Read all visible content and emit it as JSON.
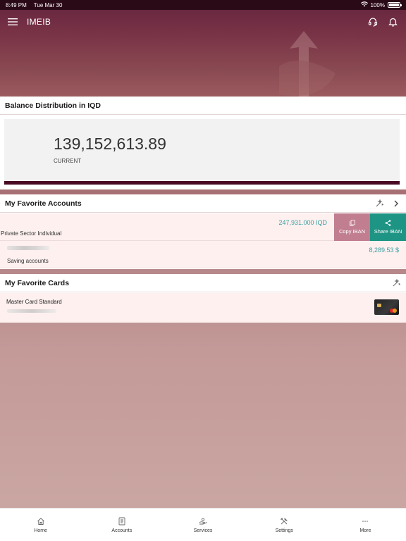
{
  "status_bar": {
    "time": "8:49 PM",
    "date": "Tue Mar 30",
    "battery": "100%",
    "battery_level": 1.0
  },
  "header": {
    "app_title": "IMEIB",
    "icons": [
      "menu-icon",
      "headset-icon",
      "bell-icon"
    ]
  },
  "balance": {
    "title": "Balance Distribution in IQD",
    "amount": "139,152,613.89",
    "label": "CURRENT"
  },
  "favorite_accounts": {
    "title": "My Favorite Accounts",
    "accounts": [
      {
        "name": "Private Sector Individual",
        "amount": "247,931.000 IQD"
      },
      {
        "name": "Saving accounts",
        "amount": "8,289.53 $"
      }
    ],
    "actions": {
      "copy_label": "Copy IBAN",
      "share_label": "Share IBAN"
    }
  },
  "favorite_cards": {
    "title": "My Favorite Cards",
    "cards": [
      {
        "name": "Master Card Standard"
      }
    ]
  },
  "tabs": [
    {
      "label": "Home",
      "icon": "home-icon"
    },
    {
      "label": "Accounts",
      "icon": "accounts-icon"
    },
    {
      "label": "Services",
      "icon": "services-icon"
    },
    {
      "label": "Settings",
      "icon": "settings-icon"
    },
    {
      "label": "More",
      "icon": "more-icon"
    }
  ],
  "colors": {
    "brand": "#6a2840",
    "accent_teal": "#1e9484",
    "copy_pink": "#c17e91",
    "amount_teal": "#3aa0a0"
  }
}
